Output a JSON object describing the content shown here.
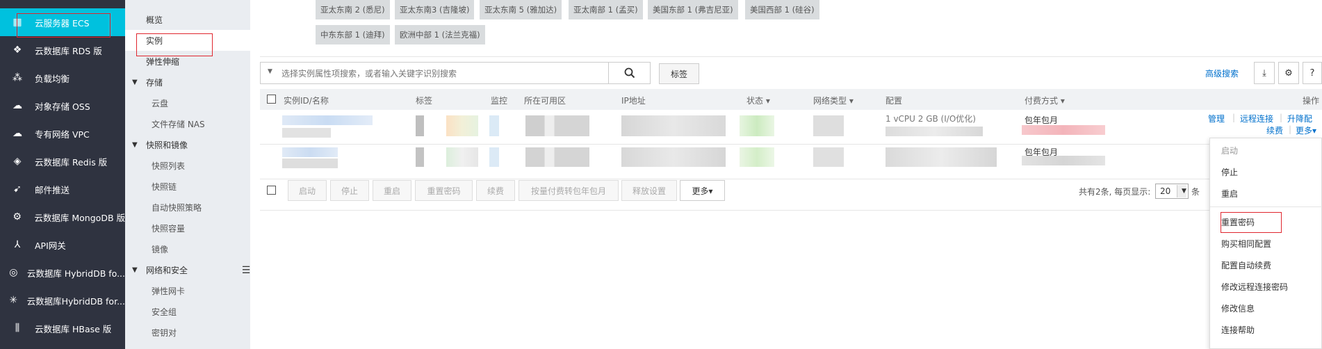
{
  "left_nav": {
    "items": [
      {
        "label": "云服务器 ECS",
        "icon": "server-grid-icon",
        "active": true
      },
      {
        "label": "云数据库 RDS 版",
        "icon": "database-icon"
      },
      {
        "label": "负载均衡",
        "icon": "load-balancer-icon"
      },
      {
        "label": "对象存储 OSS",
        "icon": "cloud-storage-icon"
      },
      {
        "label": "专有网络 VPC",
        "icon": "cloud-network-icon"
      },
      {
        "label": "云数据库 Redis 版",
        "icon": "redis-icon"
      },
      {
        "label": "邮件推送",
        "icon": "mail-push-icon"
      },
      {
        "label": "云数据库 MongoDB 版",
        "icon": "mongodb-icon"
      },
      {
        "label": "API网关",
        "icon": "api-gateway-icon"
      },
      {
        "label": "云数据库 HybridDB fo...",
        "icon": "hybriddb-icon"
      },
      {
        "label": "云数据库HybridDB for...",
        "icon": "hybriddb-cluster-icon"
      },
      {
        "label": "云数据库 HBase 版",
        "icon": "hbase-icon"
      }
    ],
    "accent_color": "#00c1de"
  },
  "sub_nav": {
    "overview": "概览",
    "instances": "实例",
    "elastic_scaling": "弹性伸缩",
    "storage_group": "存储",
    "cloud_disk": "云盘",
    "nas": "文件存储 NAS",
    "snapshot_group": "快照和镜像",
    "snapshot_list": "快照列表",
    "snapshot_chain": "快照链",
    "auto_snapshot": "自动快照策略",
    "snapshot_capacity": "快照容量",
    "image": "镜像",
    "network_group": "网络和安全",
    "eni": "弹性网卡",
    "security_group": "安全组",
    "key_pair": "密钥对"
  },
  "regions": {
    "row1": [
      "亚太东南 2 (悉尼)",
      "亚太东南3 (吉隆坡)",
      "亚太东南 5 (雅加达)",
      "亚太南部 1 (孟买)",
      "美国东部 1 (弗吉尼亚)",
      "美国西部 1 (硅谷)"
    ],
    "row2": [
      "中东东部 1 (迪拜)",
      "欧洲中部 1 (法兰克福)"
    ]
  },
  "toolbar": {
    "search_placeholder": "选择实例属性项搜索，或者输入关键字识别搜索",
    "tag_button": "标签",
    "advanced_search": "高级搜索",
    "help": "?"
  },
  "table": {
    "headers": {
      "id_name": "实例ID/名称",
      "tag": "标签",
      "monitor": "监控",
      "zone": "所在可用区",
      "ip": "IP地址",
      "status": "状态",
      "network_type": "网络类型",
      "config": "配置",
      "billing": "付费方式",
      "actions": "操作"
    },
    "rows": [
      {
        "config_text": "1 vCPU 2 GB (I/O优化)",
        "billing_text": "包年包月"
      },
      {
        "config_text": "",
        "billing_text": "包年包月"
      }
    ],
    "row_actions": {
      "manage": "管理",
      "remote_connect": "远程连接",
      "upgrade": "升降配",
      "renew": "续费",
      "more": "更多▾"
    }
  },
  "bulk_actions": {
    "start": "启动",
    "stop": "停止",
    "restart": "重启",
    "reset_password": "重置密码",
    "renew": "续费",
    "convert_billing": "按量付费转包年包月",
    "release_settings": "释放设置",
    "more": "更多▾"
  },
  "pager": {
    "summary": "共有2条, 每页显示:",
    "page_size": "20",
    "unit": "条"
  },
  "more_menu": {
    "items": [
      "启动",
      "停止",
      "重启",
      "重置密码",
      "购买相同配置",
      "配置自动续费",
      "修改远程连接密码",
      "修改信息",
      "连接帮助"
    ]
  }
}
